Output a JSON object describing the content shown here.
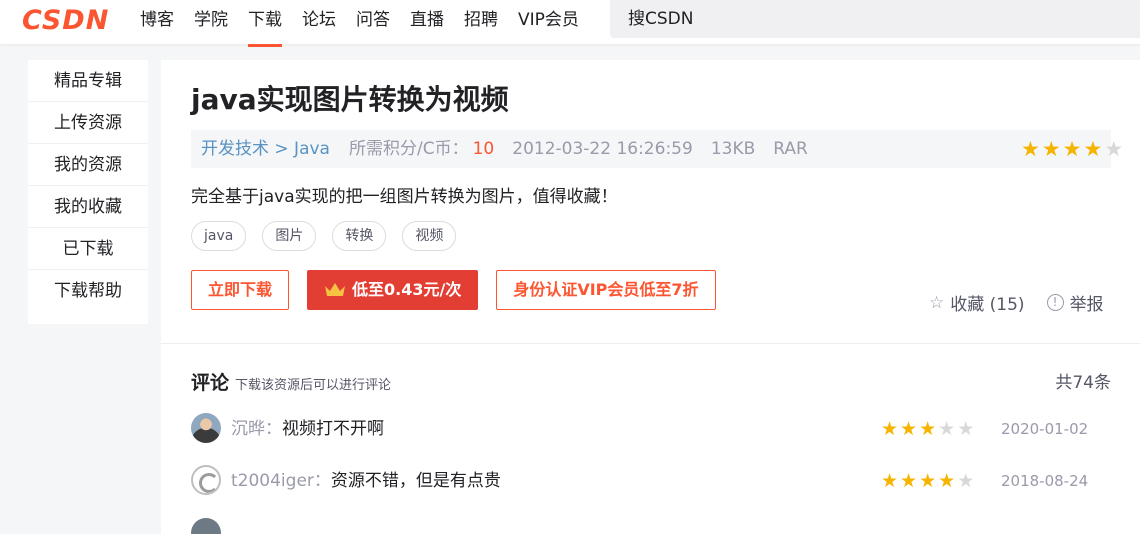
{
  "header": {
    "logo": "CSDN",
    "nav": [
      "博客",
      "学院",
      "下载",
      "论坛",
      "问答",
      "直播",
      "招聘",
      "VIP会员"
    ],
    "active_nav": "下载",
    "search_label": "搜CSDN"
  },
  "sidebar": {
    "items": [
      "精品专辑",
      "上传资源",
      "我的资源",
      "我的收藏",
      "已下载",
      "下载帮助"
    ]
  },
  "resource": {
    "title": "java实现图片转换为视频",
    "breadcrumb": "开发技术 > Java",
    "points_label": "所需积分/C币：",
    "points": "10",
    "date": "2012-03-22 16:26:59",
    "size": "13KB",
    "format": "RAR",
    "rating": 4,
    "rating_max": 5,
    "description": "完全基于java实现的把一组图片转换为图片，值得收藏！",
    "tags": [
      "java",
      "图片",
      "转换",
      "视频"
    ],
    "buttons": {
      "download": "立即下载",
      "vip_price": "低至0.43元/次",
      "vip_discount": "身份认证VIP会员低至7折"
    },
    "favorite_label": "收藏 (15)",
    "report_label": "举报"
  },
  "comments": {
    "title": "评论",
    "tip": "下载该资源后可以进行评论",
    "count_label": "共74条",
    "items": [
      {
        "user": "沉晔：",
        "text": "视频打不开啊",
        "rating": 3,
        "date": "2020-01-02"
      },
      {
        "user": "t2004iger：",
        "text": "资源不错，但是有点贵",
        "rating": 4,
        "date": "2018-08-24"
      }
    ]
  },
  "colors": {
    "brand": "#fc5531",
    "link": "#5893c2",
    "star": "#f6b400",
    "vip_button": "#e33e33"
  }
}
